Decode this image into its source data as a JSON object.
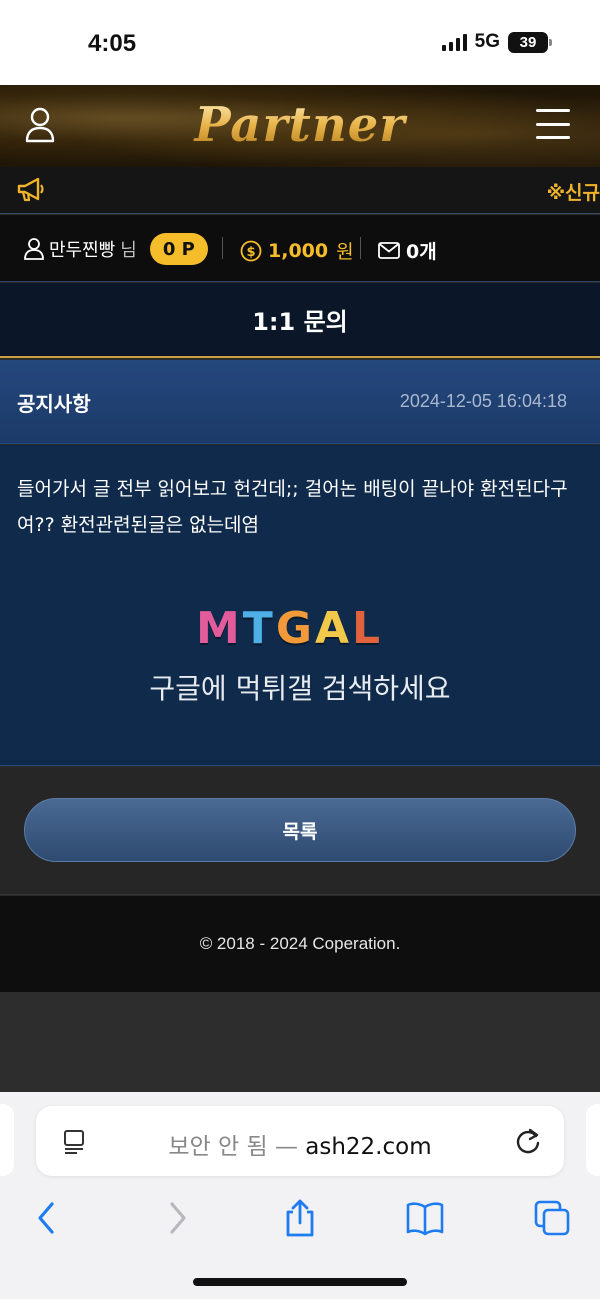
{
  "status": {
    "time": "4:05",
    "network": "5G",
    "battery": "39"
  },
  "header": {
    "logo": "Partner"
  },
  "notice": {
    "ticker": "※신규"
  },
  "user": {
    "name": "만두찐빵",
    "suffix": "님",
    "points": "0 P",
    "money": "1,000",
    "money_unit": "원",
    "messages": "0개"
  },
  "page": {
    "title": "1:1 문의"
  },
  "post": {
    "title": "공지사항",
    "date": "2024-12-05 16:04:18",
    "body": "들어가서 글 전부 읽어보고 헌건데;; 걸어논 배팅이 끝나야 환전된다구여?? 환전관련된글은 없는데염",
    "watermark_logo": "MTGAL",
    "watermark_text": "구글에 먹튀갤 검색하세요"
  },
  "actions": {
    "list_label": "목록"
  },
  "footer": {
    "copyright": "© 2018 - 2024 Coperation."
  },
  "browser": {
    "security_label": "보안 안 됨 —",
    "domain": "ash22.com"
  },
  "colors": {
    "accent_gold": "#f5bd2a",
    "title_bg": "#0b1628",
    "post_head": "#24477c",
    "post_body": "#0f2a4a"
  }
}
